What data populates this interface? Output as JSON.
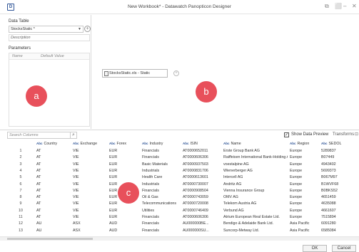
{
  "window": {
    "title": "New Workbook* - Datawatch Panopticon Designer",
    "logo": "logo-icon",
    "controls": [
      "⧉",
      "⬜",
      "‒",
      "✕"
    ]
  },
  "left_panel": {
    "data_table_label": "Data Table",
    "data_table_value": "StocksStatic *",
    "description_placeholder": "Description",
    "parameters_label": "Parameters",
    "params_cols": [
      "Name",
      "Default Value"
    ]
  },
  "canvas": {
    "node_label": "StocksStatic.xls - Static",
    "plus": "+"
  },
  "badges": [
    "a",
    "b",
    "c"
  ],
  "toolbar": {
    "search_placeholder": "Search Columns",
    "show_preview_label": "Show Data Preview",
    "show_preview_checked": "✓",
    "transforms_label": "Transforms"
  },
  "grid": {
    "type_tag": "Abc",
    "columns": [
      "",
      "Country",
      "Exchange",
      "Forex",
      "Industry",
      "ISIN",
      "Name",
      "Region",
      "SEDOL"
    ],
    "rows": [
      [
        "1",
        "AT",
        "VIE",
        "EUR",
        "Financials",
        "AT0000652011",
        "Erste Group Bank AG",
        "Europe",
        "5289837"
      ],
      [
        "2",
        "AT",
        "VIE",
        "EUR",
        "Financials",
        "AT0000606306",
        "Raiffeisen International Bank-Holding AG",
        "Europe",
        "B07449"
      ],
      [
        "3",
        "AT",
        "VIE",
        "EUR",
        "Basic Materials",
        "AT0000937503",
        "voestalpine AG",
        "Europe",
        "4943402"
      ],
      [
        "4",
        "AT",
        "VIE",
        "EUR",
        "Industrials",
        "AT0000831706",
        "Wienerberger AG",
        "Europe",
        "5699373"
      ],
      [
        "5",
        "AT",
        "VIE",
        "EUR",
        "Health Care",
        "AT0000613601",
        "Intercell AG",
        "Europe",
        "B067M97"
      ],
      [
        "6",
        "AT",
        "VIE",
        "EUR",
        "Industrials",
        "AT0000730007",
        "Andritz AG",
        "Europe",
        "B1WVF68"
      ],
      [
        "7",
        "AT",
        "VIE",
        "EUR",
        "Financials",
        "AT0000908504",
        "Vienna Insurance Group",
        "Europe",
        "B0BKS52"
      ],
      [
        "8",
        "AT",
        "VIE",
        "EUR",
        "Oil & Gas",
        "AT0000743059",
        "OMV AG",
        "Europe",
        "4651459"
      ],
      [
        "9",
        "AT",
        "VIE",
        "EUR",
        "Telecommunications",
        "AT0000720008",
        "Telekom Austria AG",
        "Europe",
        "4635088"
      ],
      [
        "10",
        "AT",
        "VIE",
        "EUR",
        "Utilities",
        "AT0000746409",
        "Verbund AG",
        "Europe",
        "4661607"
      ],
      [
        "11",
        "AT",
        "VIE",
        "EUR",
        "Financials",
        "AT0000606306",
        "Atrium European Real Estate Ltd.",
        "Europe",
        "7515894"
      ],
      [
        "12",
        "AU",
        "ASX",
        "AUD",
        "Financials",
        "AU000000BE...",
        "Bendigo & Adelaide Bank Ltd.",
        "Asia Pacific",
        "6091280"
      ],
      [
        "13",
        "AU",
        "ASX",
        "AUD",
        "Financials",
        "AU000000SU...",
        "Suncorp-Metway Ltd.",
        "Asia Pacific",
        "6585084"
      ]
    ]
  },
  "footer": {
    "ok_label": "OK",
    "cancel_label": "Cancel"
  },
  "colors": {
    "badge": "#e8505b",
    "type_tag": "#2f5597"
  }
}
